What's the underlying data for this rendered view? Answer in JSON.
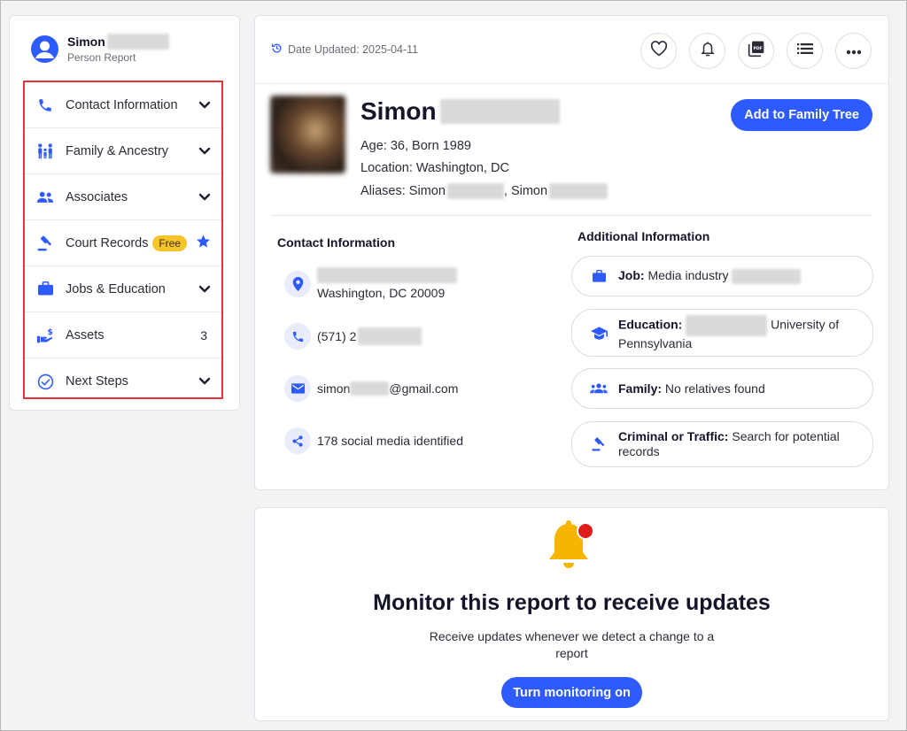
{
  "sidebar": {
    "profile": {
      "name": "Simon",
      "subtitle": "Person Report"
    },
    "items": [
      {
        "label": "Contact Information",
        "icon": "phone-icon",
        "right": "chevron"
      },
      {
        "label": "Family & Ancestry",
        "icon": "family-icon",
        "right": "chevron"
      },
      {
        "label": "Associates",
        "icon": "people-icon",
        "right": "chevron"
      },
      {
        "label": "Court Records",
        "icon": "gavel-icon",
        "badge": "Free",
        "right": "star"
      },
      {
        "label": "Jobs & Education",
        "icon": "briefcase-icon",
        "right": "chevron"
      },
      {
        "label": "Assets",
        "icon": "assets-icon",
        "count": "3"
      },
      {
        "label": "Next Steps",
        "icon": "check-circle-icon",
        "right": "chevron"
      }
    ]
  },
  "header": {
    "date_updated": "Date Updated: 2025-04-11"
  },
  "person": {
    "first_name": "Simon",
    "age_line": "Age: 36, Born 1989",
    "location_line": "Location: Washington, DC",
    "aliases_prefix": "Aliases: Simon",
    "aliases_second": ", Simon",
    "add_family_tree": "Add to Family Tree"
  },
  "contact": {
    "title": "Contact Information",
    "address_city": "Washington, DC 20009",
    "phone_prefix": "(571) 2",
    "email_prefix": "simon",
    "email_suffix": "@gmail.com",
    "social": "178 social media identified"
  },
  "additional": {
    "title": "Additional Information",
    "job_label": "Job:",
    "job_value": "Media industry",
    "education_label": "Education:",
    "education_value_1": "University of",
    "education_value_2": "Pennsylvania",
    "family_label": "Family:",
    "family_value": "No relatives found",
    "criminal_label": "Criminal or Traffic:",
    "criminal_value": "Search for potential",
    "criminal_value_2": "records"
  },
  "monitor": {
    "title": "Monitor this report to receive updates",
    "subtitle": "Receive updates whenever we detect a change to a report",
    "button": "Turn monitoring on"
  },
  "colors": {
    "accent": "#2e5bff",
    "highlight_border": "#e0373d",
    "badge": "#f7c42b",
    "bell": "#f7b500",
    "bell_dot": "#e01b1b"
  }
}
